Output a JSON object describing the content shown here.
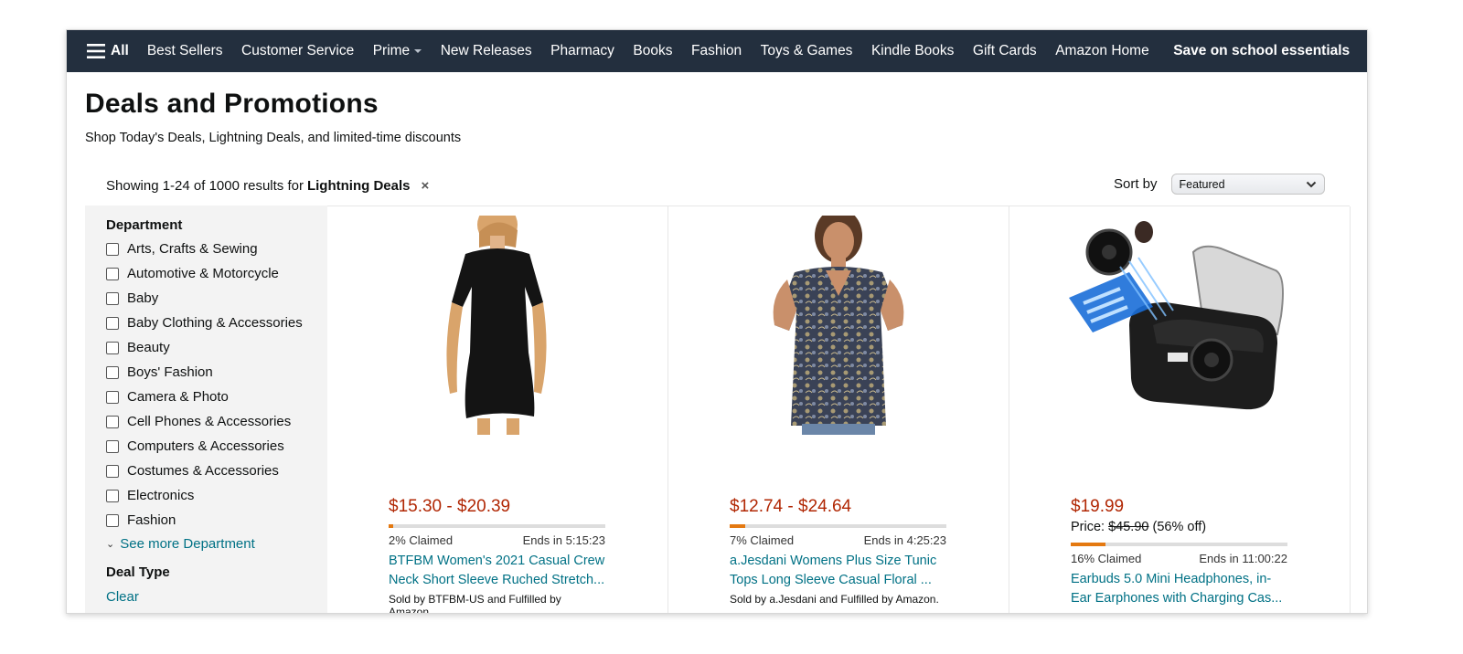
{
  "nav": {
    "all_label": "All",
    "items": [
      "Best Sellers",
      "Customer Service",
      "Prime",
      "New Releases",
      "Pharmacy",
      "Books",
      "Fashion",
      "Toys & Games",
      "Kindle Books",
      "Gift Cards",
      "Amazon Home"
    ],
    "promo": "Save on school essentials",
    "bg_color": "#232f3e"
  },
  "header": {
    "title": "Deals and Promotions",
    "subtitle": "Shop Today's Deals, Lightning Deals, and limited-time discounts"
  },
  "results": {
    "prefix": "Showing 1-24 of 1000 results for",
    "query": "Lightning Deals",
    "clear_glyph": "×"
  },
  "sort": {
    "label": "Sort by",
    "selected": "Featured"
  },
  "sidebar": {
    "department_heading": "Department",
    "departments": [
      "Arts, Crafts & Sewing",
      "Automotive & Motorcycle",
      "Baby",
      "Baby Clothing & Accessories",
      "Beauty",
      "Boys' Fashion",
      "Camera & Photo",
      "Cell Phones & Accessories",
      "Computers & Accessories",
      "Costumes & Accessories",
      "Electronics",
      "Fashion"
    ],
    "see_more": "See more Department",
    "deal_type_heading": "Deal Type",
    "clear": "Clear"
  },
  "deals": [
    {
      "price": "$15.30 - $20.39",
      "claimed": "2% Claimed",
      "claimed_fraction": 0.02,
      "ends": "Ends in 5:15:23",
      "title_line1": "BTFBM Women's 2021 Casual Crew",
      "title_line2": "Neck Short Sleeve Ruched Stretch...",
      "sold_by": "Sold by BTFBM-US and Fulfilled by Amazon."
    },
    {
      "price": "$12.74 - $24.64",
      "claimed": "7% Claimed",
      "claimed_fraction": 0.07,
      "ends": "Ends in 4:25:23",
      "title_line1": "a.Jesdani Womens Plus Size Tunic",
      "title_line2": "Tops Long Sleeve Casual Floral ...",
      "sold_by": "Sold by a.Jesdani and Fulfilled by Amazon."
    },
    {
      "price": "$19.99",
      "list_price_label": "Price:",
      "list_price": "$45.90",
      "discount": "(56% off)",
      "claimed": "16% Claimed",
      "claimed_fraction": 0.16,
      "ends": "Ends in 11:00:22",
      "title_line1": "Earbuds 5.0 Mini Headphones, in-",
      "title_line2": "Ear Earphones with Charging Cas..."
    }
  ],
  "colors": {
    "price": "#b12704",
    "link": "#007185",
    "claimed_bar": "#e47911"
  }
}
